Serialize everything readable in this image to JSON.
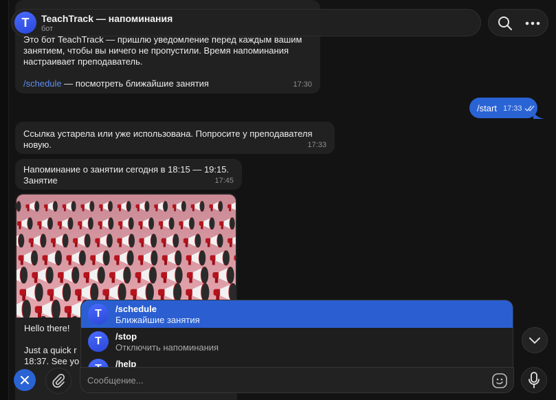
{
  "header": {
    "avatar_letter": "T",
    "title": "TeachTrack — напоминания",
    "subtitle": "бот",
    "actions": [
      {
        "icon": "search-icon"
      },
      {
        "icon": "more-icon"
      }
    ]
  },
  "messages": [
    {
      "direction": "incoming",
      "lines": [
        "Это бот TeachTrack — пришлю уведомление перед каждым вашим",
        "занятием, чтобы вы ничего не пропустили. Время напоминания",
        "настраивает преподаватель."
      ],
      "link": "/schedule",
      "link_suffix": " — посмотреть ближайшие занятия",
      "time": "17:30"
    },
    {
      "direction": "outgoing",
      "text": "/start",
      "time": "17:33",
      "status": "read-double-check-icon"
    },
    {
      "direction": "incoming",
      "lines": [
        "Ссылка устарела или уже использована. Попросите у преподавателя",
        "новую."
      ],
      "time": "17:33"
    },
    {
      "direction": "incoming",
      "lines": [
        "Напоминание о занятии сегодня в 18:15 — 19:15.",
        "Занятие"
      ],
      "time": "17:45"
    },
    {
      "direction": "incoming",
      "type": "photo",
      "image_description": "rows of red and white megaphones",
      "lines": [
        "Hello there!",
        "Just a quick r",
        "18:37. See yo"
      ]
    }
  ],
  "suggestions": [
    {
      "avatar_letter": "T",
      "command": "/schedule",
      "description": "Ближайшие занятия",
      "active": true
    },
    {
      "avatar_letter": "T",
      "command": "/stop",
      "description": "Отключить напоминания",
      "active": false
    },
    {
      "avatar_letter": "T",
      "command": "/help",
      "description": "",
      "active": false
    }
  ],
  "composer": {
    "placeholder": "Сообщение...",
    "close_icon": "close-icon",
    "attach_icon": "paperclip-icon",
    "emoji_icon": "emoji-icon",
    "mic_icon": "microphone-icon",
    "scroll_icon": "chevron-down-icon"
  },
  "colors": {
    "background": "#131313",
    "bubble_in": "#212121",
    "bubble_out": "#2a63d4",
    "accent": "#2b5fd1",
    "link": "#5e8ef0"
  }
}
